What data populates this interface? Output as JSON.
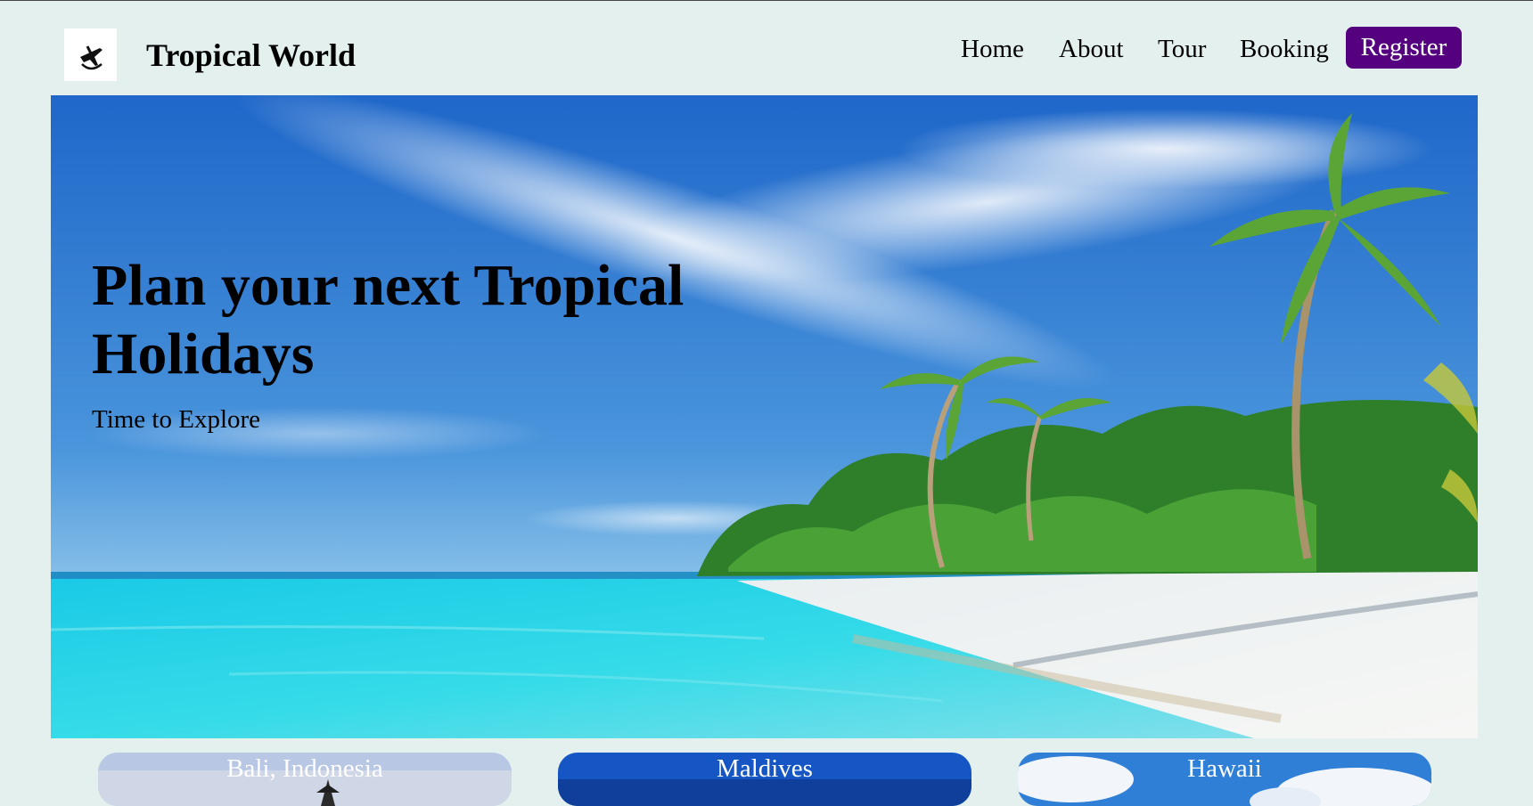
{
  "brand": {
    "name": "Tropical World",
    "logo_icon": "plane-icon"
  },
  "nav": {
    "items": [
      {
        "label": "Home"
      },
      {
        "label": "About"
      },
      {
        "label": "Tour"
      },
      {
        "label": "Booking"
      }
    ],
    "register_label": "Register"
  },
  "hero": {
    "title": "Plan your next Tropical Holidays",
    "subtitle": "Time to Explore"
  },
  "destinations": [
    {
      "name": "Bali, Indonesia"
    },
    {
      "name": "Maldives"
    },
    {
      "name": "Hawaii"
    }
  ],
  "colors": {
    "background": "#e3f0ee",
    "register_button": "#55007f"
  }
}
